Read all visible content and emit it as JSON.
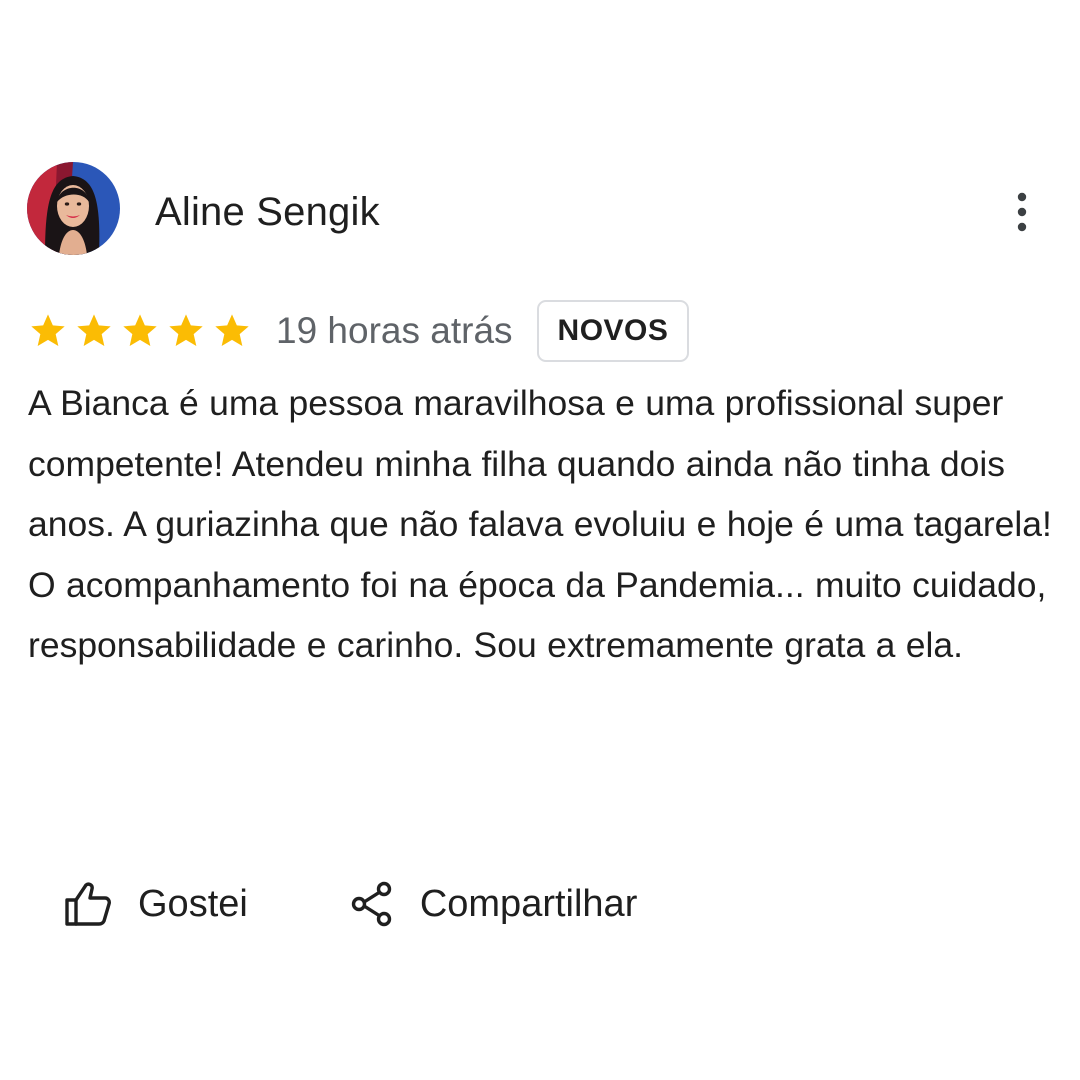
{
  "review": {
    "author_name": "Aline Sengik",
    "avatar_icon": "user-photo-avatar",
    "more_icon": "more-vertical-icon",
    "rating": 5,
    "rating_max": 5,
    "star_color": "#fbbc04",
    "time_ago": "19 horas atrás",
    "badge": "NOVOS",
    "text": "A Bianca é uma pessoa maravilhosa e uma profissional super competente! Atendeu minha filha quando ainda não tinha dois anos. A guriazinha que não falava evoluiu e hoje é uma tagarela! O acompanhamento foi na época da Pandemia... muito cuidado, responsabilidade e carinho. Sou extremamente grata a ela."
  },
  "actions": {
    "like_label": "Gostei",
    "like_icon": "thumb-up-icon",
    "share_label": "Compartilhar",
    "share_icon": "share-icon"
  }
}
